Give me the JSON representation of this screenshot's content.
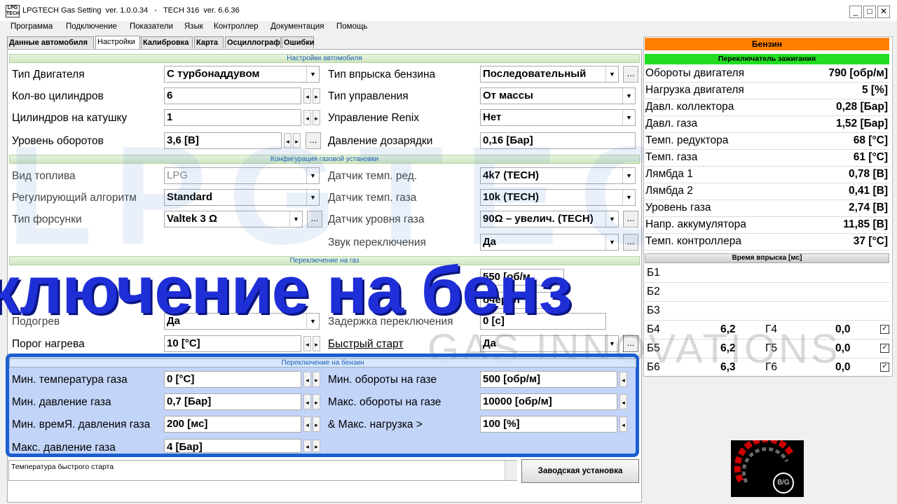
{
  "window": {
    "app_icon_text": "LPG TECH",
    "title": "LPGTECH Gas Setting  ver. 1.0.0.34   -   TECH 316  ver. 6.6.36",
    "minimize": "_",
    "maximize": "□",
    "close": "✕"
  },
  "menu": [
    "Программа",
    "Подключение",
    "Показатели",
    "Язык",
    "Контроллер",
    "Документация",
    "Помощь"
  ],
  "tabs": [
    "Данные автомобиля",
    "Настройки",
    "Калибровка",
    "Карта",
    "Осциллограф",
    "Ошибки"
  ],
  "sections": {
    "car_settings": "Настройки автомобиля",
    "gas_config": "Конфигурация газовой установки",
    "switch_to_gas": "Переключение на газ",
    "switch_to_petrol": "Переключение на бензин"
  },
  "car": {
    "engine_type_label": "Тип Двигателя",
    "engine_type_value": "С турбонаддувом",
    "cylinders_label": "Кол-во цилиндров",
    "cylinders_value": "6",
    "coil_label": "Цилиндров на катушку",
    "coil_value": "1",
    "rpm_level_label": "Уровень оборотов",
    "rpm_level_value": "3,6 [В]",
    "injection_type_label": "Тип впрыска бензина",
    "injection_type_value": "Последовательный",
    "control_type_label": "Тип управления",
    "control_type_value": "От массы",
    "renix_label": "Управление Renix",
    "renix_value": "Нет",
    "boost_label": "Давление дозарядки",
    "boost_value": "0,16 [Бар]"
  },
  "gas": {
    "fuel_type_label": "Вид топлива",
    "fuel_type_value": "LPG",
    "algorithm_label": "Регулирующий алгоритм",
    "algorithm_value": "Standard",
    "injector_label": "Тип форсунки",
    "injector_value": "Valtek 3 Ω",
    "reducer_temp_sensor_label": "Датчик темп. ред.",
    "reducer_temp_sensor_value": "4k7 (TECH)",
    "gas_temp_sensor_label": "Датчик темп. газа",
    "gas_temp_sensor_value": "10k (TECH)",
    "gas_level_sensor_label": "Датчик уровня газа",
    "gas_level_sensor_value": "90Ω – увелич. (TECH)",
    "switch_sound_label": "Звук переключения",
    "switch_sound_value": "Да"
  },
  "switch_gas": {
    "rpm_value": "550 [об/м",
    "order_value": "очерел",
    "row3_left_label": "Подогрев",
    "row3_left_value": "Да",
    "delay_label": "Задержка переключения",
    "delay_value": "0 [с]",
    "heat_threshold_label": "Порог нагрева",
    "heat_threshold_value": "10 [°C]",
    "quick_start_label": "Быстрый старт",
    "quick_start_value": "Да"
  },
  "switch_petrol": {
    "min_gas_temp_label": "Мин. температура газа",
    "min_gas_temp_value": "0 [°C]",
    "min_gas_pressure_label": "Мин. давление газа",
    "min_gas_pressure_value": "0,7 [Бар]",
    "min_pressure_time_label": "Мин. времЯ. давления газа",
    "min_pressure_time_value": "200 [мс]",
    "max_gas_pressure_label": "Макс. давление газа",
    "max_gas_pressure_value": "4 [Бар]",
    "min_rpm_gas_label": "Мин. обороты на газе",
    "min_rpm_gas_value": "500 [обр/м]",
    "max_rpm_gas_label": "Макс. обороты на газе",
    "max_rpm_gas_value": "10000 [обр/м]",
    "max_load_label": "& Макс. нагрузка >",
    "max_load_value": "100 [%]"
  },
  "overlay": {
    "banner": "ключение на бенз",
    "watermark_big": "LPGTECH",
    "watermark_small": "GAS INNOVATIONS"
  },
  "status": {
    "current_fuel": "Бензин",
    "ignition_switch": "Переключатель зажигания",
    "readings": [
      {
        "label": "Обороты двигателя",
        "value": "790 [обр/м]"
      },
      {
        "label": "Нагрузка двигателя",
        "value": "5 [%]"
      },
      {
        "label": "Давл. коллектора",
        "value": "0,28 [Бар]"
      },
      {
        "label": "Давл. газа",
        "value": "1,52 [Бар]"
      },
      {
        "label": "Темп. редуктора",
        "value": "68 [°C]"
      },
      {
        "label": "Темп. газа",
        "value": "61 [°C]"
      },
      {
        "label": "Лямбда 1",
        "value": "0,78 [В]"
      },
      {
        "label": "Лямбда 2",
        "value": "0,41 [В]"
      },
      {
        "label": "Уровень газа",
        "value": "2,74 [В]"
      },
      {
        "label": "Напр. аккумулятора",
        "value": "11,85 [В]"
      },
      {
        "label": "Темп. контроллера",
        "value": "37 [°C]"
      }
    ],
    "injection_title": "Время впрыска [мс]",
    "injection": [
      {
        "b": "Б1",
        "bv": "",
        "g": "",
        "gv": "",
        "checked": false
      },
      {
        "b": "Б2",
        "bv": "",
        "g": "",
        "gv": "",
        "checked": false
      },
      {
        "b": "Б3",
        "bv": "",
        "g": "",
        "gv": "",
        "checked": false
      },
      {
        "b": "Б4",
        "bv": "6,2",
        "g": "Г4",
        "gv": "0,0",
        "checked": true
      },
      {
        "b": "Б5",
        "bv": "6,2",
        "g": "Г5",
        "gv": "0,0",
        "checked": true
      },
      {
        "b": "Б6",
        "bv": "6,3",
        "g": "Г6",
        "gv": "0,0",
        "checked": true
      }
    ],
    "check_mark": "✓"
  },
  "bottom": {
    "hint_text": "Температура быстрого старта",
    "factory_button": "Заводская установка",
    "logo_text": "B/G"
  },
  "glyphs": {
    "dropdown": "▼",
    "spin_left": "◂",
    "spin_right": "▸",
    "dots": "..."
  }
}
